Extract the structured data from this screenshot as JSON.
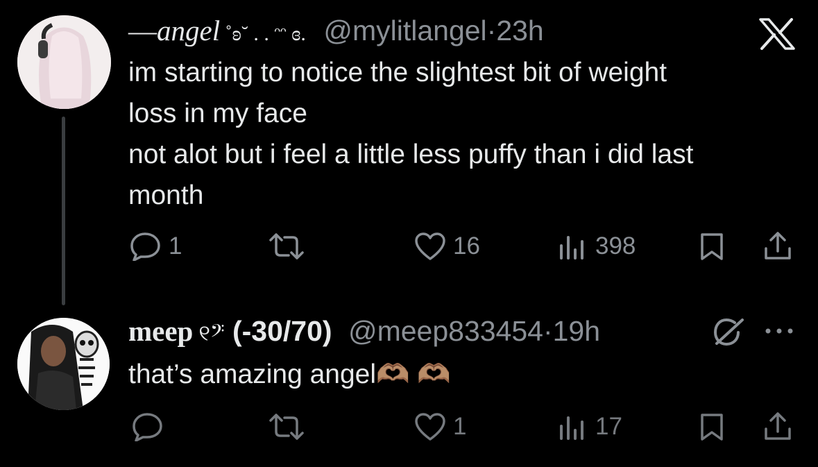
{
  "tweet1": {
    "display_name_prefix": "—",
    "display_name_main": "angel",
    "display_name_suffix": " ˚ʚ˘ . . ᵔᵔ ɞ.",
    "handle": "@mylitlangel",
    "separator": "·",
    "time": "23h",
    "lines": [
      "im starting to notice the slightest bit of weight",
      "loss in my face",
      "not alot but i feel a little less puffy than i did last",
      "month"
    ],
    "replies": "1",
    "likes": "16",
    "views": "398"
  },
  "tweet2": {
    "display_name_main": "meep",
    "display_name_symbols": " ୧𝄢",
    "display_name_count": " (-30/70)",
    "handle": "@meep833454",
    "separator": "·",
    "time": "19h",
    "text": "that’s amazing angel🫶🏽 🫶🏽",
    "likes": "1",
    "views": "17"
  },
  "icons": {
    "logo": "x-logo-icon",
    "reply": "speech-bubble-icon",
    "retweet": "retweet-icon",
    "like": "heart-icon",
    "views": "bar-chart-icon",
    "bookmark": "bookmark-icon",
    "share": "share-icon",
    "grok": "grok-icon",
    "more": "more-dots-icon"
  },
  "colors": {
    "background": "#000000",
    "text": "#e7e9ea",
    "muted": "#8b9096",
    "thread_line": "#3a3d40"
  }
}
